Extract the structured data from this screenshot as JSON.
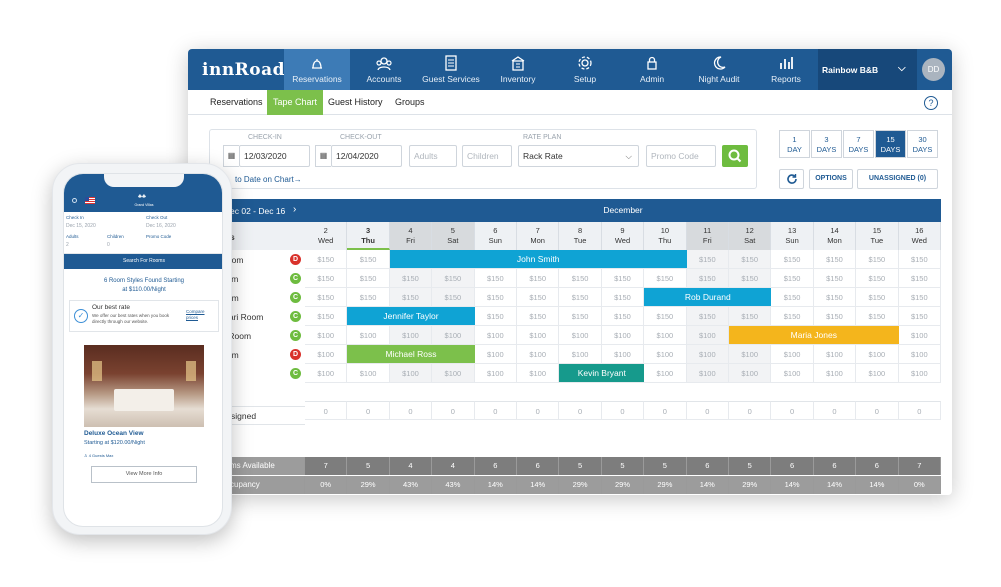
{
  "app": {
    "logo": "innRoad",
    "property": "Rainbow B&B",
    "avatar": "DD"
  },
  "nav": [
    {
      "label": "Reservations",
      "icon": "bell-icon",
      "active": true
    },
    {
      "label": "Accounts",
      "icon": "accounts-icon",
      "active": false
    },
    {
      "label": "Guest Services",
      "icon": "clipboard-icon",
      "active": false
    },
    {
      "label": "Inventory",
      "icon": "inventory-icon",
      "active": false
    },
    {
      "label": "Setup",
      "icon": "gear-icon",
      "active": false
    },
    {
      "label": "Admin",
      "icon": "lock-icon",
      "active": false
    },
    {
      "label": "Night Audit",
      "icon": "moon-icon",
      "active": false
    },
    {
      "label": "Reports",
      "icon": "bar-chart-icon",
      "active": false
    }
  ],
  "subtabs": [
    "Reservations",
    "Tape Chart",
    "Guest History",
    "Groups"
  ],
  "search": {
    "checkin_label": "CHECK-IN",
    "checkin": "12/03/2020",
    "checkout_label": "CHECK-OUT",
    "checkout": "12/04/2020",
    "adults_ph": "Adults",
    "children_ph": "Children",
    "rateplan_label": "RATE PLAN",
    "rateplan": "Rack Rate",
    "promo_ph": "Promo Code",
    "goto_link": "to Date on Chart→"
  },
  "days": [
    {
      "n": "1",
      "u": "DAY"
    },
    {
      "n": "3",
      "u": "DAYS"
    },
    {
      "n": "7",
      "u": "DAYS"
    },
    {
      "n": "15",
      "u": "DAYS"
    },
    {
      "n": "30",
      "u": "DAYS"
    }
  ],
  "options_label": "OPTIONS",
  "unassigned_label": "UNASSIGNED (0)",
  "range": "ec 02 - Dec 16",
  "month": "December",
  "rooms_header": "s",
  "dates": [
    [
      "2",
      "Wed"
    ],
    [
      "3",
      "Thu"
    ],
    [
      "4",
      "Fri"
    ],
    [
      "5",
      "Sat"
    ],
    [
      "6",
      "Sun"
    ],
    [
      "7",
      "Mon"
    ],
    [
      "8",
      "Tue"
    ],
    [
      "9",
      "Wed"
    ],
    [
      "10",
      "Thu"
    ],
    [
      "11",
      "Fri"
    ],
    [
      "12",
      "Sat"
    ],
    [
      "13",
      "Sun"
    ],
    [
      "14",
      "Mon"
    ],
    [
      "15",
      "Tue"
    ],
    [
      "16",
      "Wed"
    ]
  ],
  "rooms": [
    {
      "name": "ed Room",
      "badge": "D",
      "rate": "$150"
    },
    {
      "name": "v Room",
      "badge": "C",
      "rate": "$150"
    },
    {
      "name": "e Room",
      "badge": "C",
      "rate": "$150"
    },
    {
      "name": "o Safari Room",
      "badge": "C",
      "rate": "$150"
    },
    {
      "name": "Blue Room",
      "badge": "C",
      "rate": "$100"
    },
    {
      "name": "o Room",
      "badge": "D",
      "rate": "$100"
    },
    {
      "name": " Room",
      "badge": "C",
      "rate": "$100"
    }
  ],
  "bookings": [
    {
      "guest": "John Smith",
      "row": 0,
      "start": 2,
      "span": 7,
      "color": "#0fa3d4"
    },
    {
      "guest": "Rob Durand",
      "row": 2,
      "start": 8,
      "span": 3,
      "color": "#0fa3d4"
    },
    {
      "guest": "Jennifer Taylor",
      "row": 3,
      "start": 1,
      "span": 3,
      "color": "#0fa3d4"
    },
    {
      "guest": "Maria Jones",
      "row": 4,
      "start": 10,
      "span": 4,
      "color": "#f4b51c"
    },
    {
      "guest": "Michael Ross",
      "row": 5,
      "start": 1,
      "span": 3,
      "color": "#7cc04b"
    },
    {
      "guest": "Kevin Bryant",
      "row": 6,
      "start": 6,
      "span": 2,
      "color": "#169a8c"
    }
  ],
  "unassigned_row": {
    "label": "signed",
    "value": "0"
  },
  "rooms_available": {
    "label": "ms Available",
    "values": [
      "7",
      "5",
      "4",
      "4",
      "6",
      "6",
      "5",
      "5",
      "5",
      "6",
      "5",
      "6",
      "6",
      "6",
      "7"
    ]
  },
  "occupancy": {
    "label": "cupancy",
    "values": [
      "0%",
      "29%",
      "43%",
      "43%",
      "14%",
      "14%",
      "29%",
      "29%",
      "29%",
      "14%",
      "29%",
      "14%",
      "14%",
      "14%",
      "0%"
    ]
  },
  "mobile": {
    "checkin_label": "Check In",
    "checkin": "Dec 15, 2020",
    "checkout_label": "Check Out",
    "checkout": "Dec 16, 2020",
    "adults_label": "Adults",
    "adults": "2",
    "children_label": "Children",
    "children": "0",
    "promo_label": "Promo Code",
    "search_btn": "Search For Rooms",
    "found_line1": "6 Room Styles Found Starting",
    "found_line2": "at $110.00/Night",
    "best_title": "Our best rate",
    "best_body": "We offer our best rates when you book directly through our website.",
    "compare": "Compare prices",
    "room_name": "Deluxe Ocean View",
    "room_price": "Starting at $120.00/Night",
    "guests": "4 Guests Max",
    "view_btn": "View More Info",
    "brand": "Grand Villas"
  }
}
